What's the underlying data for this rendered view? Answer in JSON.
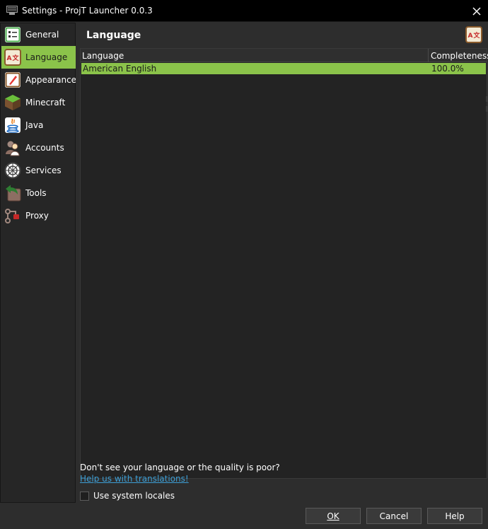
{
  "window": {
    "title": "Settings - ProjT Launcher 0.0.3"
  },
  "sidebar": {
    "items": [
      {
        "label": "General",
        "icon": "general-icon"
      },
      {
        "label": "Language",
        "icon": "language-icon",
        "active": true
      },
      {
        "label": "Appearance",
        "icon": "appearance-icon"
      },
      {
        "label": "Minecraft",
        "icon": "minecraft-icon"
      },
      {
        "label": "Java",
        "icon": "java-icon"
      },
      {
        "label": "Accounts",
        "icon": "accounts-icon"
      },
      {
        "label": "Services",
        "icon": "services-icon"
      },
      {
        "label": "Tools",
        "icon": "tools-icon"
      },
      {
        "label": "Proxy",
        "icon": "proxy-icon"
      }
    ]
  },
  "page": {
    "title": "Language"
  },
  "table": {
    "columns": [
      "Language",
      "Completeness"
    ],
    "rows": [
      {
        "language": "American English",
        "completeness": "100.0%"
      }
    ]
  },
  "footer_text": {
    "hint": "Don't see your language or the quality is poor?",
    "link": "Help us with translations!",
    "checkbox_label": "Use system locales"
  },
  "buttons": {
    "ok": "OK",
    "cancel": "Cancel",
    "help": "Help"
  },
  "colors": {
    "accent": "#8bc34a",
    "link": "#3d9fd6",
    "background": "#2d2d2d"
  }
}
